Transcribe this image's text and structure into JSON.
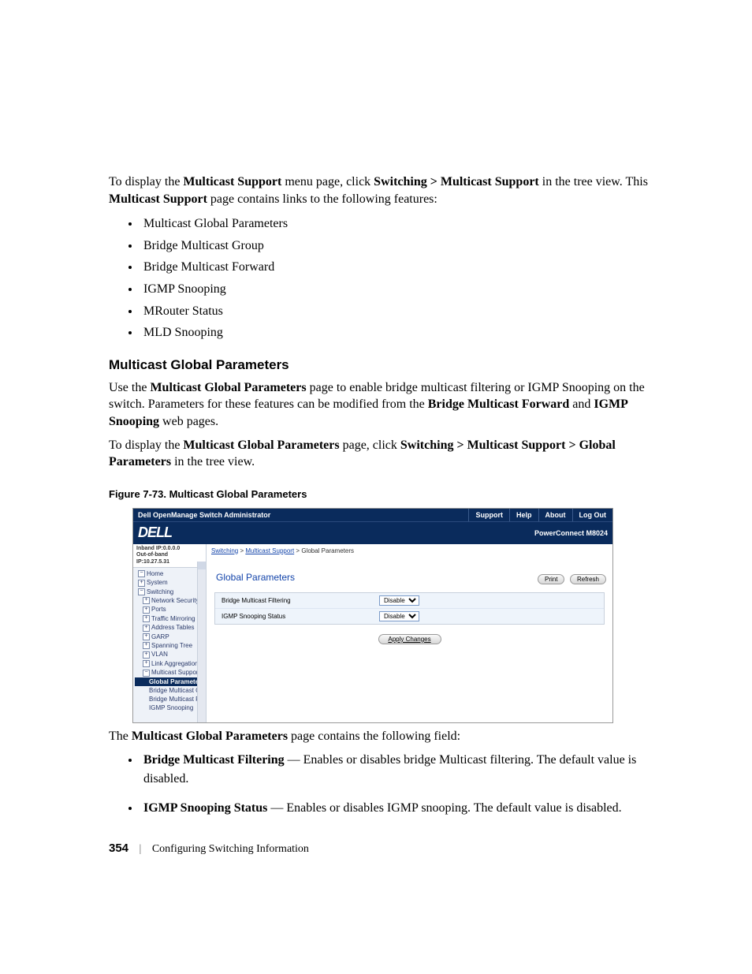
{
  "intro": {
    "p1_pre": "To display the ",
    "p1_b1": "Multicast Support",
    "p1_mid1": " menu page, click ",
    "p1_b2": "Switching > Multicast Support",
    "p1_mid2": " in the tree view. This ",
    "p1_b3": "Multicast Support",
    "p1_post": " page contains links to the following features:"
  },
  "features": [
    "Multicast Global Parameters",
    "Bridge Multicast Group",
    "Bridge Multicast Forward",
    "IGMP Snooping",
    "MRouter Status",
    "MLD Snooping"
  ],
  "section_heading": "Multicast Global Parameters",
  "use": {
    "pre": "Use the ",
    "b1": "Multicast Global Parameters",
    "mid1": " page to enable bridge multicast filtering or IGMP Snooping on the switch. Parameters for these features can be modified from the ",
    "b2": "Bridge Multicast Forward",
    "and": " and ",
    "b3": "IGMP Snooping",
    "post": " web pages."
  },
  "display": {
    "pre": "To display the ",
    "b1": "Multicast Global Parameters",
    "mid": " page, click ",
    "b2": "Switching > Multicast Support > Global Parameters",
    "post": " in the tree view."
  },
  "figure_caption": "Figure 7-73.    Multicast Global Parameters",
  "ss": {
    "app_title": "Dell OpenManage Switch Administrator",
    "nav": {
      "support": "Support",
      "help": "Help",
      "about": "About",
      "logout": "Log Out"
    },
    "logo": "DELL",
    "model": "PowerConnect M8024",
    "ip1": "Inband IP:0.0.0.0",
    "ip2": "Out-of-band IP:10.27.5.31",
    "tree": {
      "home": "Home",
      "system": "System",
      "switching": "Switching",
      "netsec": "Network Security",
      "ports": "Ports",
      "traffic": "Traffic Mirroring",
      "addr": "Address Tables",
      "garp": "GARP",
      "span": "Spanning Tree",
      "vlan": "VLAN",
      "linkagg": "Link Aggregation",
      "mcast": "Multicast Support",
      "gparam": "Global Parameters",
      "bmg": "Bridge Multicast G",
      "bmf": "Bridge Multicast F",
      "igmp": "IGMP Snooping"
    },
    "crumb": {
      "a1": "Switching",
      "a2": "Multicast Support",
      "cur": "Global Parameters",
      "sep": " > "
    },
    "page_title": "Global Parameters",
    "btn_print": "Print",
    "btn_refresh": "Refresh",
    "row1": "Bridge Multicast Filtering",
    "row2": "IGMP Snooping Status",
    "opt": "Disable",
    "apply": "Apply Changes"
  },
  "after_fig": {
    "pre": "The ",
    "b": "Multicast Global Parameters",
    "post": " page contains the following field:"
  },
  "fields": {
    "f1_b": "Bridge Multicast Filtering",
    "f1_txt": " — Enables or disables bridge Multicast filtering. The default value is disabled.",
    "f2_b": "IGMP Snooping Status",
    "f2_txt": " — Enables or disables IGMP snooping. The default value is disabled."
  },
  "footer": {
    "page": "354",
    "chapter": "Configuring Switching Information",
    "sep": "|"
  }
}
